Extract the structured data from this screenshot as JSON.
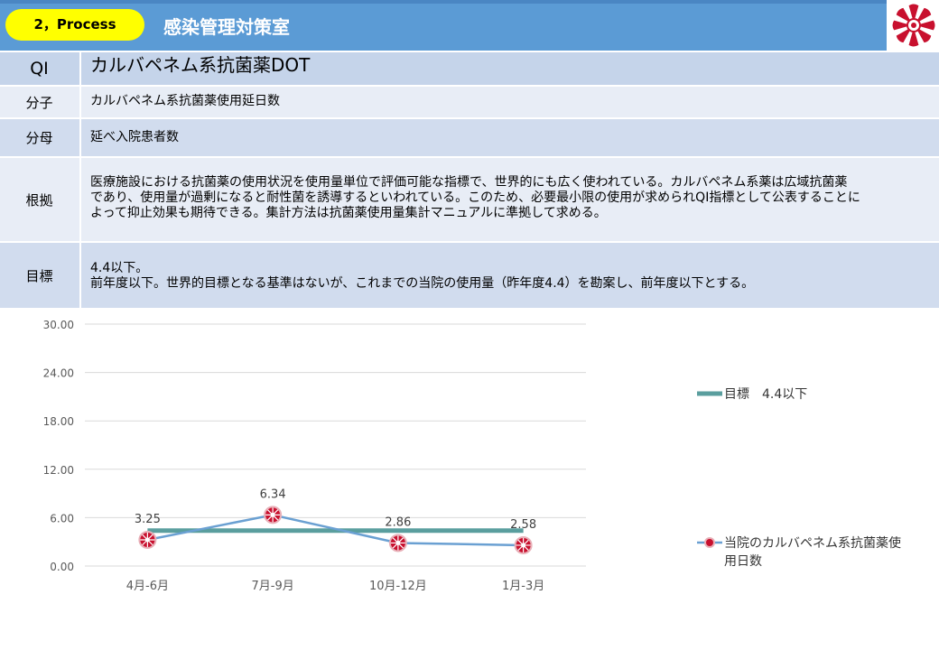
{
  "header": {
    "badge": "2，Process",
    "department": "感染管理対策室"
  },
  "table": {
    "qi_label": "QI",
    "qi_value": "カルバペネム系抗菌薬DOT",
    "numerator_label": "分子",
    "numerator_value": "カルバペネム系抗菌薬使用延日数",
    "denominator_label": "分母",
    "denominator_value": "延べ入院患者数",
    "rationale_label": "根拠",
    "rationale_lines": [
      "医療施設における抗菌薬の使用状況を使用量単位で評価可能な指標で、世界的にも広く使われている。カルバペネム系薬は広域抗菌薬",
      "であり、使用量が過剰になると耐性菌を誘導するといわれている。このため、必要最小限の使用が求められQI指標として公表することに",
      "よって抑止効果も期待できる。集計方法は抗菌薬使用量集計マニュアルに準拠して求める。"
    ],
    "target_label": "目標",
    "target_lines": [
      "4.4以下。",
      "前年度以下。世界的目標となる基準はないが、これまでの当院の使用量（昨年度4.4）を勘案し、前年度以下とする。"
    ]
  },
  "chart_data": {
    "type": "line",
    "categories": [
      "4月-6月",
      "7月-9月",
      "10月-12月",
      "1月-3月"
    ],
    "yticks": [
      "0.00",
      "6.00",
      "12.00",
      "18.00",
      "24.00",
      "30.00"
    ],
    "ylim": [
      0,
      30
    ],
    "grid": true,
    "legend_position": "right",
    "series": [
      {
        "name": "目標　4.4以下",
        "values": [
          4.4,
          4.4,
          4.4,
          4.4
        ],
        "color": "#5a9e9e"
      },
      {
        "name": "当院のカルバペネム系抗菌薬使用日数",
        "values": [
          3.25,
          6.34,
          2.86,
          2.58
        ],
        "labels": [
          "3.25",
          "6.34",
          "2.86",
          "2.58"
        ],
        "color": "#6aa0d2",
        "marker_color": "#c8102e"
      }
    ],
    "legend_lines": {
      "target": "目標　4.4以下",
      "actual_1": "当院のカルバペネム系抗菌薬使",
      "actual_2": "用日数"
    }
  }
}
